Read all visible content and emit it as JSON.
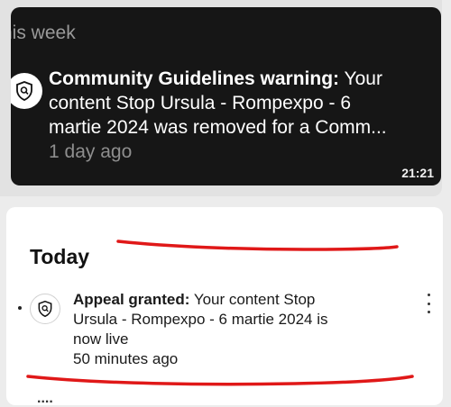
{
  "older_section": {
    "header": "his week",
    "notification": {
      "title": "Community Guidelines warning:",
      "body_line1": "Your",
      "body_line2": "content Stop Ursula - Rompexpo - 6",
      "body_line3": "martie 2024 was removed for a Comm...",
      "time": "1 day ago",
      "icon": "shield-search-icon"
    },
    "clock": "21:21"
  },
  "today_section": {
    "header": "Today",
    "notification": {
      "title": "Appeal granted:",
      "body_line1": "Your content Stop",
      "body_line2": "Ursula - Rompexpo - 6 martie 2024 is",
      "body_line3": "now live",
      "time": "50 minutes ago",
      "icon": "shield-search-icon",
      "menu_icon": "more-vertical-icon"
    },
    "next_item_peek": "...."
  },
  "colors": {
    "dark_panel": "#161616",
    "annotation_red": "#e01818"
  }
}
